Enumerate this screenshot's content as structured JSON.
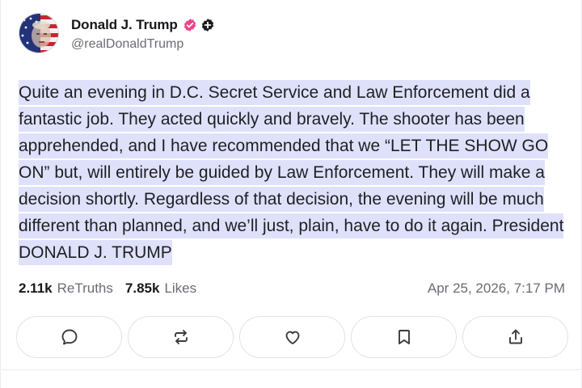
{
  "post": {
    "author": {
      "display_name": "Donald J. Trump",
      "handle": "@realDonaldTrump",
      "avatar_icon": "flag-portrait-avatar",
      "verified_icon": "verified-badge-icon",
      "plus_icon": "plus-badge-icon"
    },
    "text": "Quite an evening in D.C. Secret Service and Law Enforcement did a fantastic job. They acted quickly and bravely. The shooter has been apprehended, and I have recommended that we “LET THE SHOW GO ON” but, will entirely be guided by Law Enforcement. They will make a decision shortly. Regardless of that decision, the evening will be much different than planned, and we’ll just, plain, have to do it again. President DONALD J. TRUMP",
    "stats": {
      "retruths_count": "2.11k",
      "retruths_label": "ReTruths",
      "likes_count": "7.85k",
      "likes_label": "Likes"
    },
    "timestamp": "Apr 25, 2026, 7:17 PM"
  },
  "actions": [
    {
      "name": "reply",
      "icon": "comment-bubble-icon"
    },
    {
      "name": "retruth",
      "icon": "repost-arrows-icon"
    },
    {
      "name": "like",
      "icon": "heart-icon"
    },
    {
      "name": "bookmark",
      "icon": "bookmark-icon"
    },
    {
      "name": "share",
      "icon": "share-upload-icon"
    }
  ],
  "colors": {
    "verified": "#e8458b",
    "selection_highlight": "#dfe1fb",
    "text_primary": "#1f1f24",
    "text_secondary": "#6b6b75"
  }
}
